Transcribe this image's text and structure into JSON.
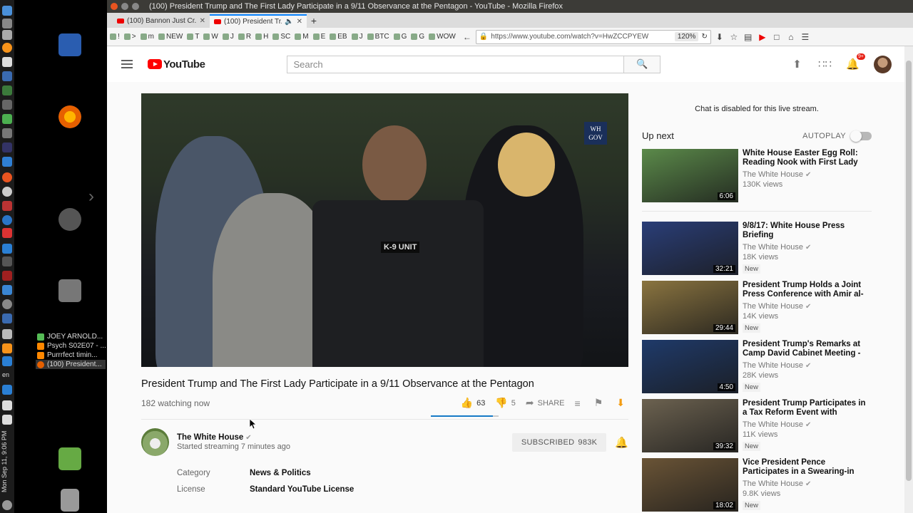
{
  "window": {
    "title": "(100) President Trump and The First Lady Participate in a 9/11 Observance at the Pentagon - YouTube - Mozilla Firefox"
  },
  "tabs": [
    {
      "label": "(100) Bannon Just Cr..."
    },
    {
      "label": "(100) President Tr..."
    }
  ],
  "bookmarks": [
    "!",
    ">",
    "m",
    "NEW",
    "T",
    "W",
    "J",
    "R",
    "H",
    "SC",
    "M",
    "E",
    "EB",
    "J",
    "BTC",
    "G",
    "G",
    "WOW"
  ],
  "urlbar": {
    "url": "https://www.youtube.com/watch?v=HwZCCPYEW",
    "zoom": "120%"
  },
  "taskbar": {
    "clock": "Mon Sep 11, 9:06 PM",
    "lang": "en",
    "tasks": [
      "JOEY ARNOLD...",
      "Psych S02E07 - ...",
      "Purrrfect timin...",
      "(100) President..."
    ]
  },
  "youtube": {
    "logo": "YouTube",
    "search_placeholder": "Search",
    "notif_badge": "9+",
    "video": {
      "title": "President Trump and The First Lady Participate in a 9/11 Observance at the Pentagon",
      "watching": "182 watching now",
      "likes": "63",
      "dislikes": "5",
      "share_label": "SHARE",
      "like_ratio": 0.92,
      "vest_label": "K-9 UNIT",
      "overlay_logo_1": "WH",
      "overlay_logo_2": "GOV"
    },
    "channel": {
      "name": "The White House",
      "status": "Started streaming 7 minutes ago",
      "subscribe_label": "SUBSCRIBED",
      "subscribers": "983K"
    },
    "meta": [
      {
        "key": "Category",
        "value": "News & Politics"
      },
      {
        "key": "License",
        "value": "Standard YouTube License"
      }
    ],
    "chat_disabled": "Chat is disabled for this live stream.",
    "up_next_label": "Up next",
    "autoplay_label": "AUTOPLAY",
    "recommendations": [
      {
        "title": "White House Easter Egg Roll: Reading Nook with First Lady",
        "channel": "The White House",
        "views": "130K views",
        "duration": "6:06",
        "new": "",
        "color": "#5b8a4a"
      },
      {
        "title": "9/8/17: White House Press Briefing",
        "channel": "The White House",
        "views": "18K views",
        "duration": "32:21",
        "new": "New",
        "color": "#2a3e78"
      },
      {
        "title": "President Trump Holds a Joint Press Conference with Amir al-",
        "channel": "The White House",
        "views": "14K views",
        "duration": "29:44",
        "new": "New",
        "color": "#8a7440"
      },
      {
        "title": "President Trump's Remarks at Camp David Cabinet Meeting -",
        "channel": "The White House",
        "views": "28K views",
        "duration": "4:50",
        "new": "New",
        "color": "#1f3a6a"
      },
      {
        "title": "President Trump Participates in a Tax Reform Event with",
        "channel": "The White House",
        "views": "11K views",
        "duration": "39:32",
        "new": "New",
        "color": "#6c6250"
      },
      {
        "title": "Vice President Pence Participates in a Swearing-in",
        "channel": "The White House",
        "views": "9.8K views",
        "duration": "18:02",
        "new": "New",
        "color": "#6a5436"
      }
    ]
  }
}
